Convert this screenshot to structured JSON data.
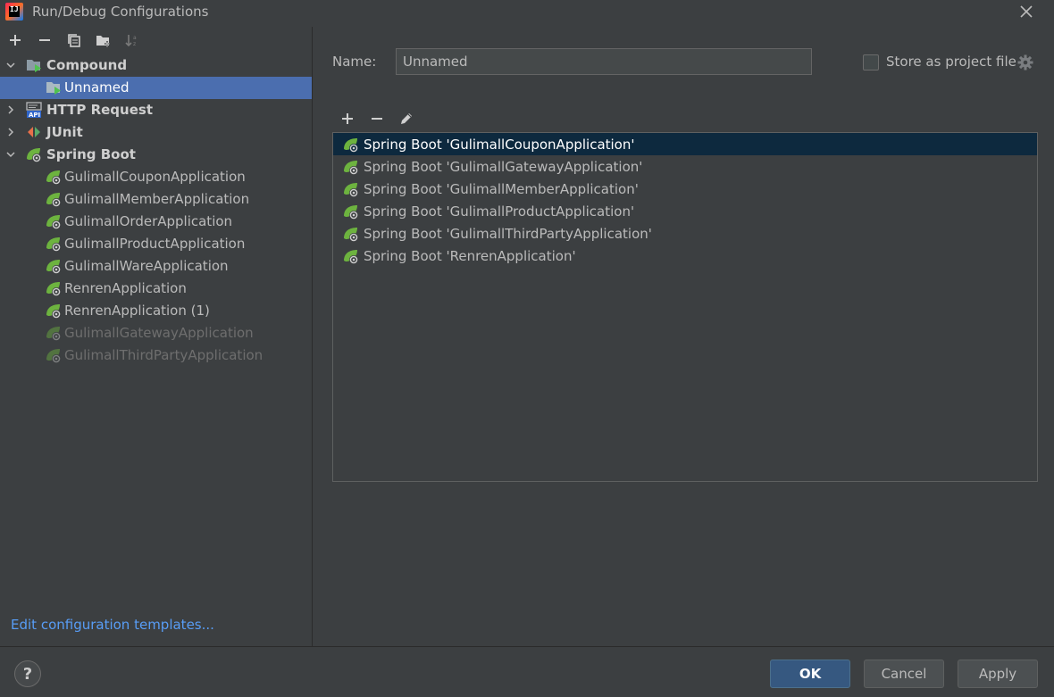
{
  "window": {
    "title": "Run/Debug Configurations"
  },
  "tree": {
    "compound": {
      "label": "Compound",
      "children": [
        "Unnamed"
      ]
    },
    "http_request": {
      "label": "HTTP Request"
    },
    "junit": {
      "label": "JUnit"
    },
    "spring_boot": {
      "label": "Spring Boot",
      "children": [
        "GulimallCouponApplication",
        "GulimallMemberApplication",
        "GulimallOrderApplication",
        "GulimallProductApplication",
        "GulimallWareApplication",
        "RenrenApplication",
        "RenrenApplication (1)"
      ],
      "disabled_children": [
        "GulimallGatewayApplication",
        "GulimallThirdPartyApplication"
      ]
    }
  },
  "left_footer": {
    "link": "Edit configuration templates..."
  },
  "form": {
    "name_label": "Name:",
    "name_value": "Unnamed",
    "store_label": "Store as project file"
  },
  "compound_list": [
    "Spring Boot 'GulimallCouponApplication'",
    "Spring Boot 'GulimallGatewayApplication'",
    "Spring Boot 'GulimallMemberApplication'",
    "Spring Boot 'GulimallProductApplication'",
    "Spring Boot 'GulimallThirdPartyApplication'",
    "Spring Boot 'RenrenApplication'"
  ],
  "buttons": {
    "help": "?",
    "ok": "OK",
    "cancel": "Cancel",
    "apply": "Apply"
  },
  "colors": {
    "background": "#3c3f41",
    "selection": "#4b6eaf",
    "list_selection": "#0d293e",
    "link": "#589df6",
    "spring_green": "#6db33f"
  }
}
